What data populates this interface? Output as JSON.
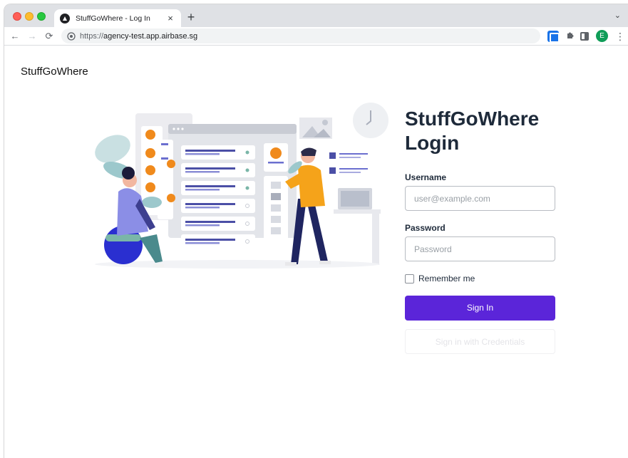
{
  "browser": {
    "tab_title": "StuffGoWhere - Log In",
    "tab_close": "×",
    "new_tab": "+",
    "tab_menu": "⌄",
    "url_scheme": "https://",
    "url_host": "agency-test.app.airbase.sg",
    "profile_initial": "E",
    "nav": {
      "back": "←",
      "forward": "→",
      "reload": "⟳"
    },
    "icons": {
      "favicon": "triangle-logo-icon",
      "site_info": "site-info-icon",
      "extension": "extension-icon",
      "puzzle": "puzzle-icon",
      "side_panel": "side-panel-icon",
      "menu": "kebab-menu-icon"
    }
  },
  "page": {
    "brand": "StuffGoWhere",
    "login": {
      "title": "StuffGoWhere Login",
      "username_label": "Username",
      "username_placeholder": "user@example.com",
      "password_label": "Password",
      "password_placeholder": "Password",
      "remember_label": "Remember me",
      "signin_label": "Sign In",
      "credentials_label": "Sign in with Credentials"
    },
    "colors": {
      "primary": "#5b25d9",
      "title": "#1e2a3a",
      "illustration_orange": "#f08a1c",
      "illustration_blue": "#2a2fd0"
    }
  }
}
